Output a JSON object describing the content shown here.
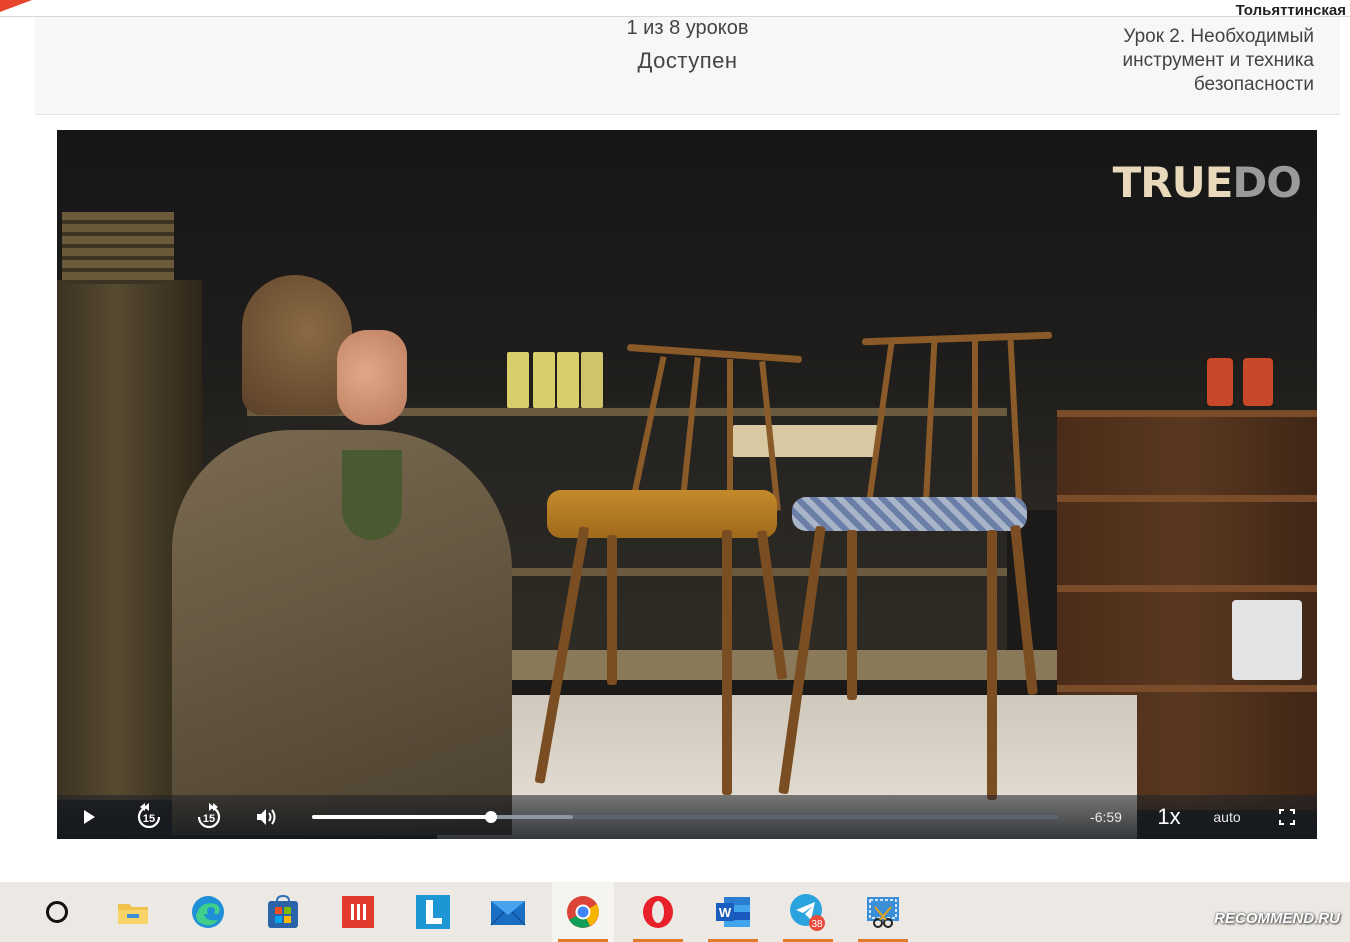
{
  "header": {
    "city": "Тольяттинская",
    "lesson_count": "1 из 8 уроков",
    "status": "Доступен",
    "next_lesson_title": "Урок 2. Необходимый инструмент и техника безопасности"
  },
  "video": {
    "brand_logo_part1": "TRUE",
    "brand_logo_part2": "DO",
    "controls": {
      "play_icon": "play-icon",
      "rewind_label": "15",
      "forward_label": "15",
      "time_remaining": "-6:59",
      "speed": "1x",
      "quality": "auto",
      "progress_fraction": 0.24,
      "buffer_fraction": 0.35
    }
  },
  "taskbar": {
    "items": [
      {
        "name": "search",
        "icon": "circle-search-icon"
      },
      {
        "name": "file-explorer",
        "icon": "folder-icon"
      },
      {
        "name": "edge",
        "icon": "edge-icon"
      },
      {
        "name": "microsoft-store",
        "icon": "store-icon"
      },
      {
        "name": "app-red",
        "icon": "red-app-icon"
      },
      {
        "name": "app-l",
        "icon": "l-app-icon"
      },
      {
        "name": "mail",
        "icon": "mail-icon"
      },
      {
        "name": "chrome",
        "icon": "chrome-icon"
      },
      {
        "name": "opera",
        "icon": "opera-icon"
      },
      {
        "name": "word",
        "icon": "word-icon"
      },
      {
        "name": "telegram",
        "icon": "telegram-icon"
      },
      {
        "name": "snipping-tool",
        "icon": "snip-icon"
      }
    ],
    "telegram_badge": "38"
  },
  "watermark": "RECOMMEND.RU",
  "colors": {
    "accent_underline": "#e07b2c",
    "logo_light": "#e9d9bb",
    "logo_grey": "#9a9a98"
  }
}
